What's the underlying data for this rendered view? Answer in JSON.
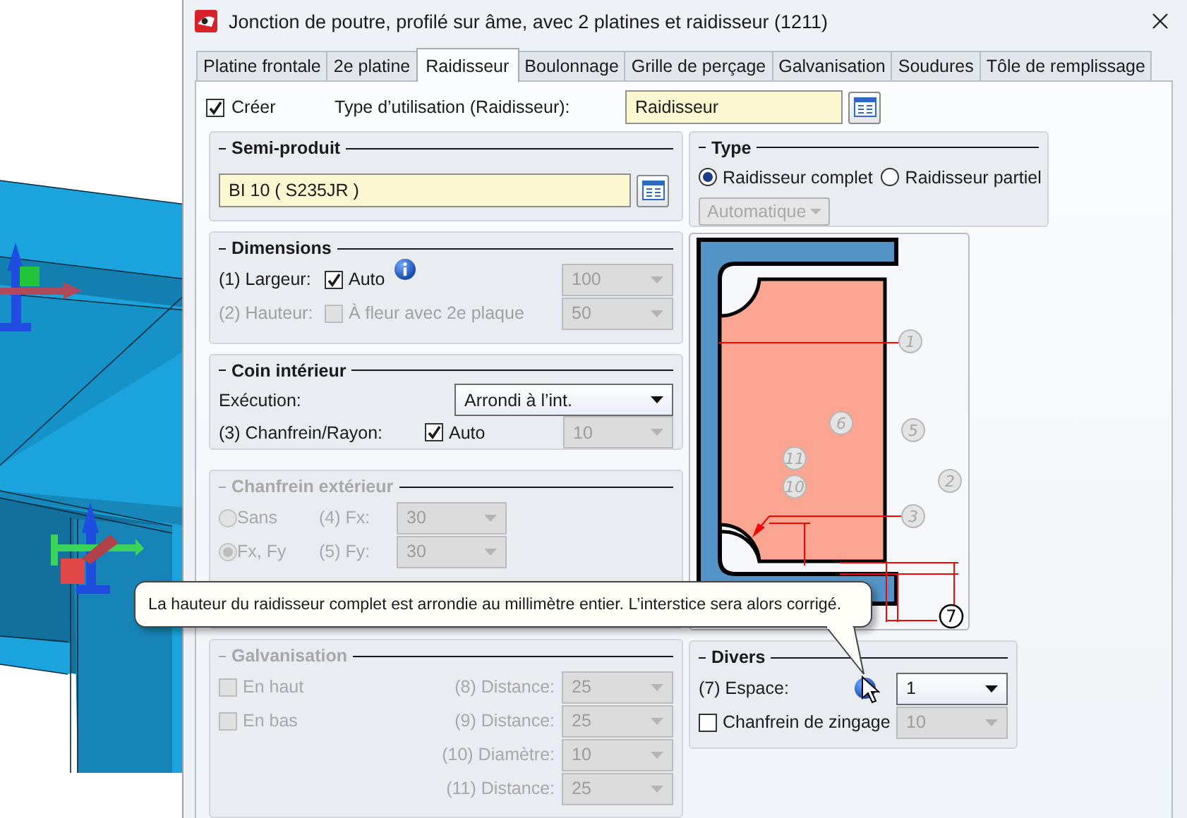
{
  "window": {
    "title": "Jonction de poutre, profilé sur âme, avec 2 platines et raidisseur (1211)"
  },
  "tabs": [
    {
      "label": "Platine frontale",
      "selected": false
    },
    {
      "label": "2e platine",
      "selected": false
    },
    {
      "label": "Raidisseur",
      "selected": true
    },
    {
      "label": "Boulonnage",
      "selected": false
    },
    {
      "label": "Grille de perçage",
      "selected": false
    },
    {
      "label": "Galvanisation",
      "selected": false
    },
    {
      "label": "Soudures",
      "selected": false
    },
    {
      "label": "Tôle de remplissage",
      "selected": false
    }
  ],
  "create": {
    "label": "Créer",
    "checked": true
  },
  "usage_type": {
    "label": "Type d’utilisation (Raidisseur):",
    "value": "Raidisseur"
  },
  "semi_product": {
    "title": "Semi-produit",
    "value": "BI 10  ( S235JR )"
  },
  "dimensions": {
    "title": "Dimensions",
    "rows": [
      {
        "label": "(1) Largeur:",
        "check_label": "Auto",
        "checked": true,
        "disabled": false,
        "info": true,
        "value": "100"
      },
      {
        "label": "(2) Hauteur:",
        "check_label": "À fleur avec 2e plaque",
        "checked": false,
        "disabled": true,
        "info": false,
        "value": "50"
      }
    ]
  },
  "inner_corner": {
    "title": "Coin intérieur",
    "execution_label": "Exécution:",
    "execution": "Arrondi à l’int.",
    "size_label": "(3) Chanfrein/Rayon:",
    "auto_label": "Auto",
    "auto_checked": true,
    "size": "10"
  },
  "outer_chamfer": {
    "title": "Chanfrein extérieur",
    "disabled": true,
    "rows": [
      {
        "option": "Sans",
        "selected": false,
        "label": "(4) Fx:",
        "value": "30"
      },
      {
        "option": "Fx, Fy",
        "selected": true,
        "label": "(5) Fy:",
        "value": "30"
      }
    ]
  },
  "galvanization": {
    "title": "Galvanisation",
    "disabled": true,
    "checks": [
      {
        "label": "En haut",
        "checked": false
      },
      {
        "label": "En bas",
        "checked": false
      }
    ],
    "distances": [
      {
        "label": "(8) Distance:",
        "value": "25"
      },
      {
        "label": "(9) Distance:",
        "value": "25"
      },
      {
        "label": "(10) Diamètre:",
        "value": "10"
      },
      {
        "label": "(11) Distance:",
        "value": "25"
      }
    ]
  },
  "type": {
    "title": "Type",
    "options": [
      {
        "label": "Raidisseur complet",
        "selected": true
      },
      {
        "label": "Raidisseur partiel",
        "selected": false
      }
    ],
    "mode": "Automatique",
    "mode_disabled": true
  },
  "diagram": {
    "markers": [
      {
        "label": "1",
        "active": false
      },
      {
        "label": "6",
        "active": false
      },
      {
        "label": "5",
        "active": false
      },
      {
        "label": "2",
        "active": false
      },
      {
        "label": "11",
        "active": false
      },
      {
        "label": "10",
        "active": false
      },
      {
        "label": "3",
        "active": false
      },
      {
        "label": "7",
        "active": true
      }
    ]
  },
  "misc": {
    "title": "Divers",
    "gap_label": "(7) Espace:",
    "gap": "1",
    "zinc_label": "Chanfrein de zingage",
    "zinc_checked": false,
    "zinc_value": "10"
  },
  "tooltip": "La hauteur du raidisseur complet est arrondie au millimètre entier. L’interstice sera alors corrigé."
}
